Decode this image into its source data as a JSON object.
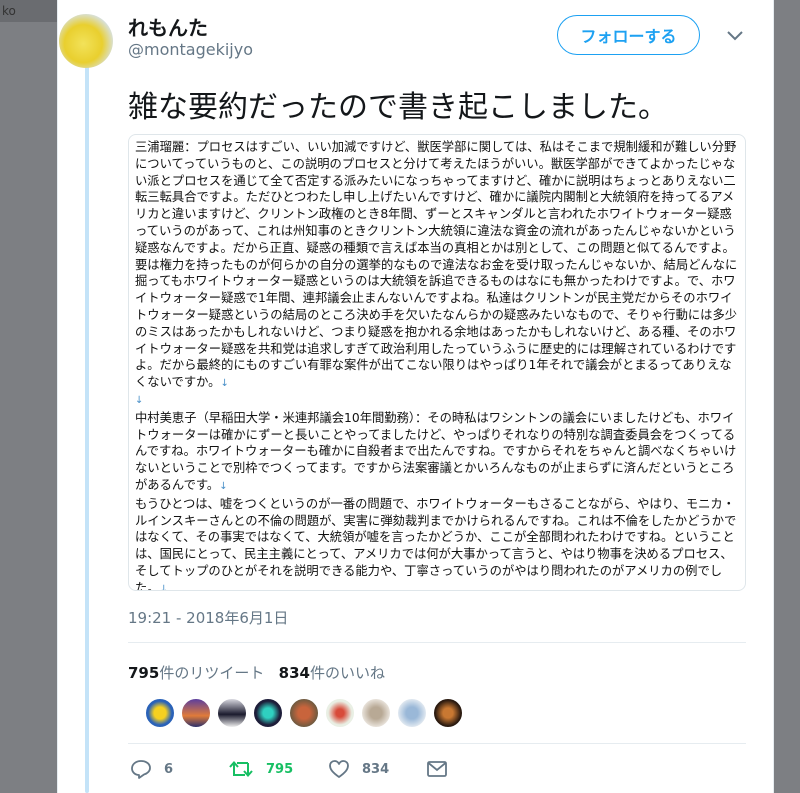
{
  "tweet": {
    "display_name": "れもんた",
    "handle": "@montagekijyo",
    "follow_label": "フォローする",
    "text": "雑な要約だったので書き起こしました。",
    "timestamp": "19:21 - 2018年6月1日",
    "retweet_count": "795",
    "retweet_label": "件のリツイート",
    "like_count": "834",
    "like_label": "件のいいね",
    "reply_action_count": "6",
    "retweet_action_count": "795",
    "like_action_count": "834"
  },
  "image_text": {
    "para1": "三浦瑠麗：プロセスはすごい、いい加減ですけど、獣医学部に関しては、私はそこまで規制緩和が難しい分野についてっていうものと、この説明のプロセスと分けて考えたほうがいい。獣医学部ができてよかったじゃない派とプロセスを通じて全て否定する派みたいになっちゃってますけど、確かに説明はちょっとありえない二転三転具合ですよ。ただひとつわたし申し上げたいんですけど、確かに議院内閣制と大統領府を持ってるアメリカと違いますけど、クリントン政権のとき8年間、ずーとスキャンダルと言われたホワイトウォーター疑惑っていうのがあって、これは州知事のときクリントン大統領に違法な資金の流れがあったんじゃないかという疑惑なんですよ。だから正直、疑惑の種類で言えば本当の真相とかは別として、この問題と似てるんですよ。要は権力を持ったものが何らかの自分の選挙的なもので違法なお金を受け取ったんじゃないか、結局どんなに掘ってもホワイトウォーター疑惑というのは大統領を訴追できるものはなにも無かったわけですよ。で、ホワイトウォーター疑惑で1年間、連邦議会止まんないんですよね。私達はクリントンが民主党だからそのホワイトウォーター疑惑というの結局のところ決め手を欠いたなんらかの疑惑みたいなもので、そりゃ行動には多少のミスはあったかもしれないけど、つまり疑惑を抱かれる余地はあったかもしれないけど、ある種、そのホワイトウォーター疑惑を共和党は追求しすぎて政治利用したっていうふうに歴史的には理解されているわけですよ。だから最終的にものすごい有罪な案件が出てこない限りはやっぱり1年それで議会がとまるってありえなくないですか。",
    "para2": "中村美恵子（早稲田大学・米連邦議会10年間勤務）：その時私はワシントンの議会にいましたけども、ホワイトウォーターは確かにずーと長いことやってましたけど、やっぱりそれなりの特別な調査委員会をつくってるんですね。ホワイトウォーターも確かに自殺者まで出たんですね。ですからそれをちゃんと調べなくちゃいけないということで別枠でつくってます。ですから法案審議とかいろんなものが止まらずに済んだというところがあるんです。",
    "para3": "もうひとつは、嘘をつくというのが一番の問題で、ホワイトウォーターもさることながら、やはり、モニカ・ルインスキーさんとの不倫の問題が、実害に弾劾裁判までかけられるんですね。これは不倫をしたかどうかではなくて、その事実ではなくて、大統領が嘘を言ったかどうか、ここが全部問われたわけですね。ということは、国民にとって、民主主義にとって、アメリカでは何が大事かって言うと、やはり物事を決めるプロセス、そしてトップのひとがそれを説明できる能力や、丁寧さっていうのがやはり問われたのがアメリカの例でした。"
  },
  "colors": {
    "accent": "#1da1f2",
    "retweet_green": "#17bf63",
    "thread_line": "#c4e3f8",
    "muted": "#657786"
  },
  "icons": [
    "chevron-down-icon",
    "reply-icon",
    "retweet-icon",
    "like-icon",
    "message-icon"
  ],
  "background_fragment": "ko"
}
